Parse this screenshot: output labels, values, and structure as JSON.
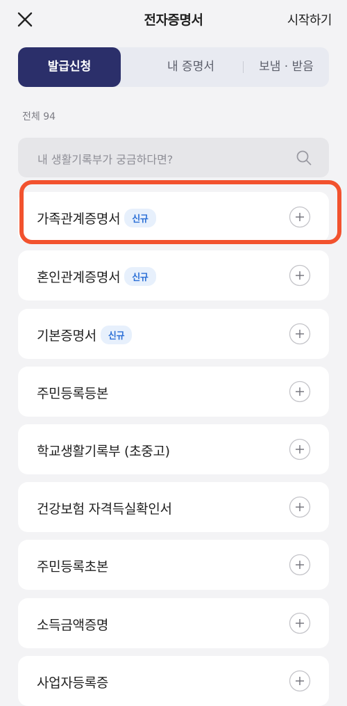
{
  "header": {
    "title": "전자증명서",
    "start_label": "시작하기"
  },
  "tabs": [
    {
      "label": "발급신청",
      "active": true
    },
    {
      "label": "내 증명서",
      "active": false
    },
    {
      "label": "보냄 · 받음",
      "active": false
    }
  ],
  "total_count": "전체 94",
  "search": {
    "placeholder": "내 생활기록부가 궁금하다면?"
  },
  "certificates": [
    {
      "label": "가족관계증명서",
      "badge": "신규"
    },
    {
      "label": "혼인관계증명서",
      "badge": "신규"
    },
    {
      "label": "기본증명서",
      "badge": "신규"
    },
    {
      "label": "주민등록등본",
      "badge": ""
    },
    {
      "label": "학교생활기록부 (초중고)",
      "badge": ""
    },
    {
      "label": "건강보험 자격득실확인서",
      "badge": ""
    },
    {
      "label": "주민등록초본",
      "badge": ""
    },
    {
      "label": "소득금액증명",
      "badge": ""
    },
    {
      "label": "사업자등록증",
      "badge": ""
    }
  ],
  "colors": {
    "background": "#f3f3f5",
    "tab_active": "#2b2f6a",
    "badge_text": "#2b6fd6",
    "badge_bg": "#e7f0fc",
    "highlight": "#f2522e"
  },
  "icons": {
    "close": "close-icon",
    "search": "search-icon",
    "add": "plus-circle-icon"
  }
}
